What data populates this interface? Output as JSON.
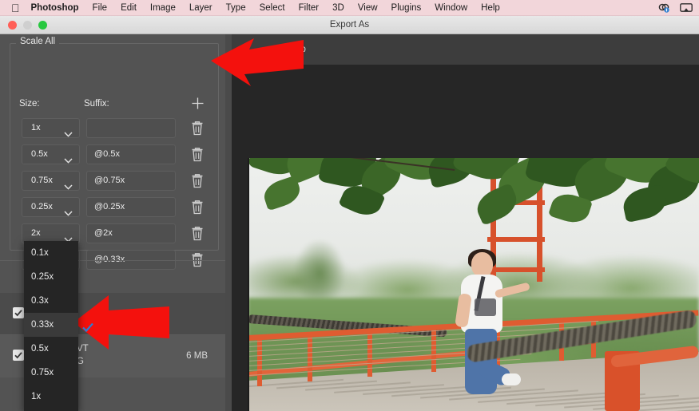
{
  "menubar": {
    "apple_icon": "apple-icon",
    "items": [
      {
        "label": "Photoshop",
        "bold": true
      },
      {
        "label": "File"
      },
      {
        "label": "Edit"
      },
      {
        "label": "Image"
      },
      {
        "label": "Layer"
      },
      {
        "label": "Type"
      },
      {
        "label": "Select"
      },
      {
        "label": "Filter"
      },
      {
        "label": "3D"
      },
      {
        "label": "View"
      },
      {
        "label": "Plugins"
      },
      {
        "label": "Window"
      },
      {
        "label": "Help"
      }
    ],
    "status_icons": [
      "dropbox-icon",
      "airplay-icon"
    ]
  },
  "window": {
    "title": "Export As",
    "traffic_lights": [
      "close",
      "minimize",
      "zoom"
    ]
  },
  "panel": {
    "group_label": "Scale All",
    "col_size": "Size:",
    "col_suffix": "Suffix:",
    "add_label": "+",
    "rows": [
      {
        "size": "1x",
        "suffix": ""
      },
      {
        "size": "0.5x",
        "suffix": "@0.5x"
      },
      {
        "size": "0.75x",
        "suffix": "@0.75x"
      },
      {
        "size": "0.25x",
        "suffix": "@0.25x"
      },
      {
        "size": "2x",
        "suffix": "@2x"
      },
      {
        "size": "0.33x",
        "suffix": "@0.33x"
      }
    ]
  },
  "file_list": {
    "rows": [
      {
        "name": "",
        "format": "",
        "size": ""
      },
      {
        "name": "VT",
        "format": "G",
        "size": "6 MB"
      }
    ]
  },
  "dropdown": {
    "options": [
      {
        "label": "0.1x",
        "checked": false
      },
      {
        "label": "0.25x",
        "checked": false
      },
      {
        "label": "0.3x",
        "checked": false
      },
      {
        "label": "0.33x",
        "checked": true
      },
      {
        "label": "0.5x",
        "checked": false
      },
      {
        "label": "0.75x",
        "checked": false
      },
      {
        "label": "1x",
        "checked": false
      }
    ],
    "check_color": "#2a7fd4"
  },
  "preview": {
    "tab_label": "2-Up",
    "image_alt": "woman-on-suspension-bridge-photo"
  },
  "annotations": {
    "arrow_color": "#f4110d",
    "arrow_1": "arrow-pointing-to-add-size-button",
    "arrow_2": "arrow-pointing-to-selected-scale-option"
  },
  "colors": {
    "panel_bg": "#535353",
    "control_bg": "#4f4f4f",
    "preview_bg": "#262626",
    "menubar_bg": "#f2d6da"
  }
}
